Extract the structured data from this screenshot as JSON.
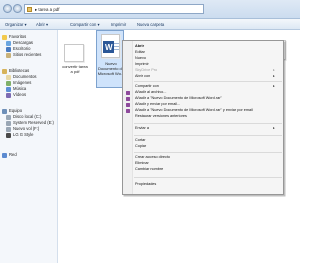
{
  "address": {
    "path": "▸ tarea a pdf"
  },
  "toolbar": {
    "organize": "Organizar ▾",
    "open": "Abrir ▾",
    "share": "Compartir con ▾",
    "print": "Imprimir",
    "new_folder": "Nueva carpeta"
  },
  "sidebar": {
    "favorites": "Favoritos",
    "downloads": "Descargas",
    "desktop": "Escritorio",
    "recent": "Sitios recientes",
    "libraries": "Bibliotecas",
    "documents": "Documentos",
    "images": "Imágenes",
    "music": "Música",
    "videos": "Vídeos",
    "computer": "Equipo",
    "local_disk": "Disco local (C:)",
    "system_reserved": "System Reserved (E:)",
    "new_volume": "Nuevo vol (F:)",
    "lg": "LG G Style",
    "network": "Red"
  },
  "files": [
    {
      "label": "convertir tarea a pdf"
    },
    {
      "label": "Nuevo Documento de Microsoft Wo..."
    }
  ],
  "menu": {
    "open": "Abrir",
    "edit": "Editar",
    "new": "Nuevo",
    "print": "Imprimir",
    "skydrive_pro": "SkyDrive Pro",
    "open_with": "Abrir con",
    "share_with": "Compartir con",
    "add_to_archive": "Añadir al archivo...",
    "add_to_rar": "Añadir a \"Nuevo Documento de Microsoft Word.rar\"",
    "compress_email": "Añadir y enviar por email...",
    "add_rar_email": "Añadir a \"Nuevo Documento de Microsoft Word.rar\" y enviar por email",
    "restore_previous": "Restaurar versiones anteriores",
    "send_to": "Enviar a",
    "cut": "Cortar",
    "copy": "Copiar",
    "create_shortcut": "Crear acceso directo",
    "delete": "Eliminar",
    "rename": "Cambiar nombre",
    "properties": "Propiedades"
  }
}
